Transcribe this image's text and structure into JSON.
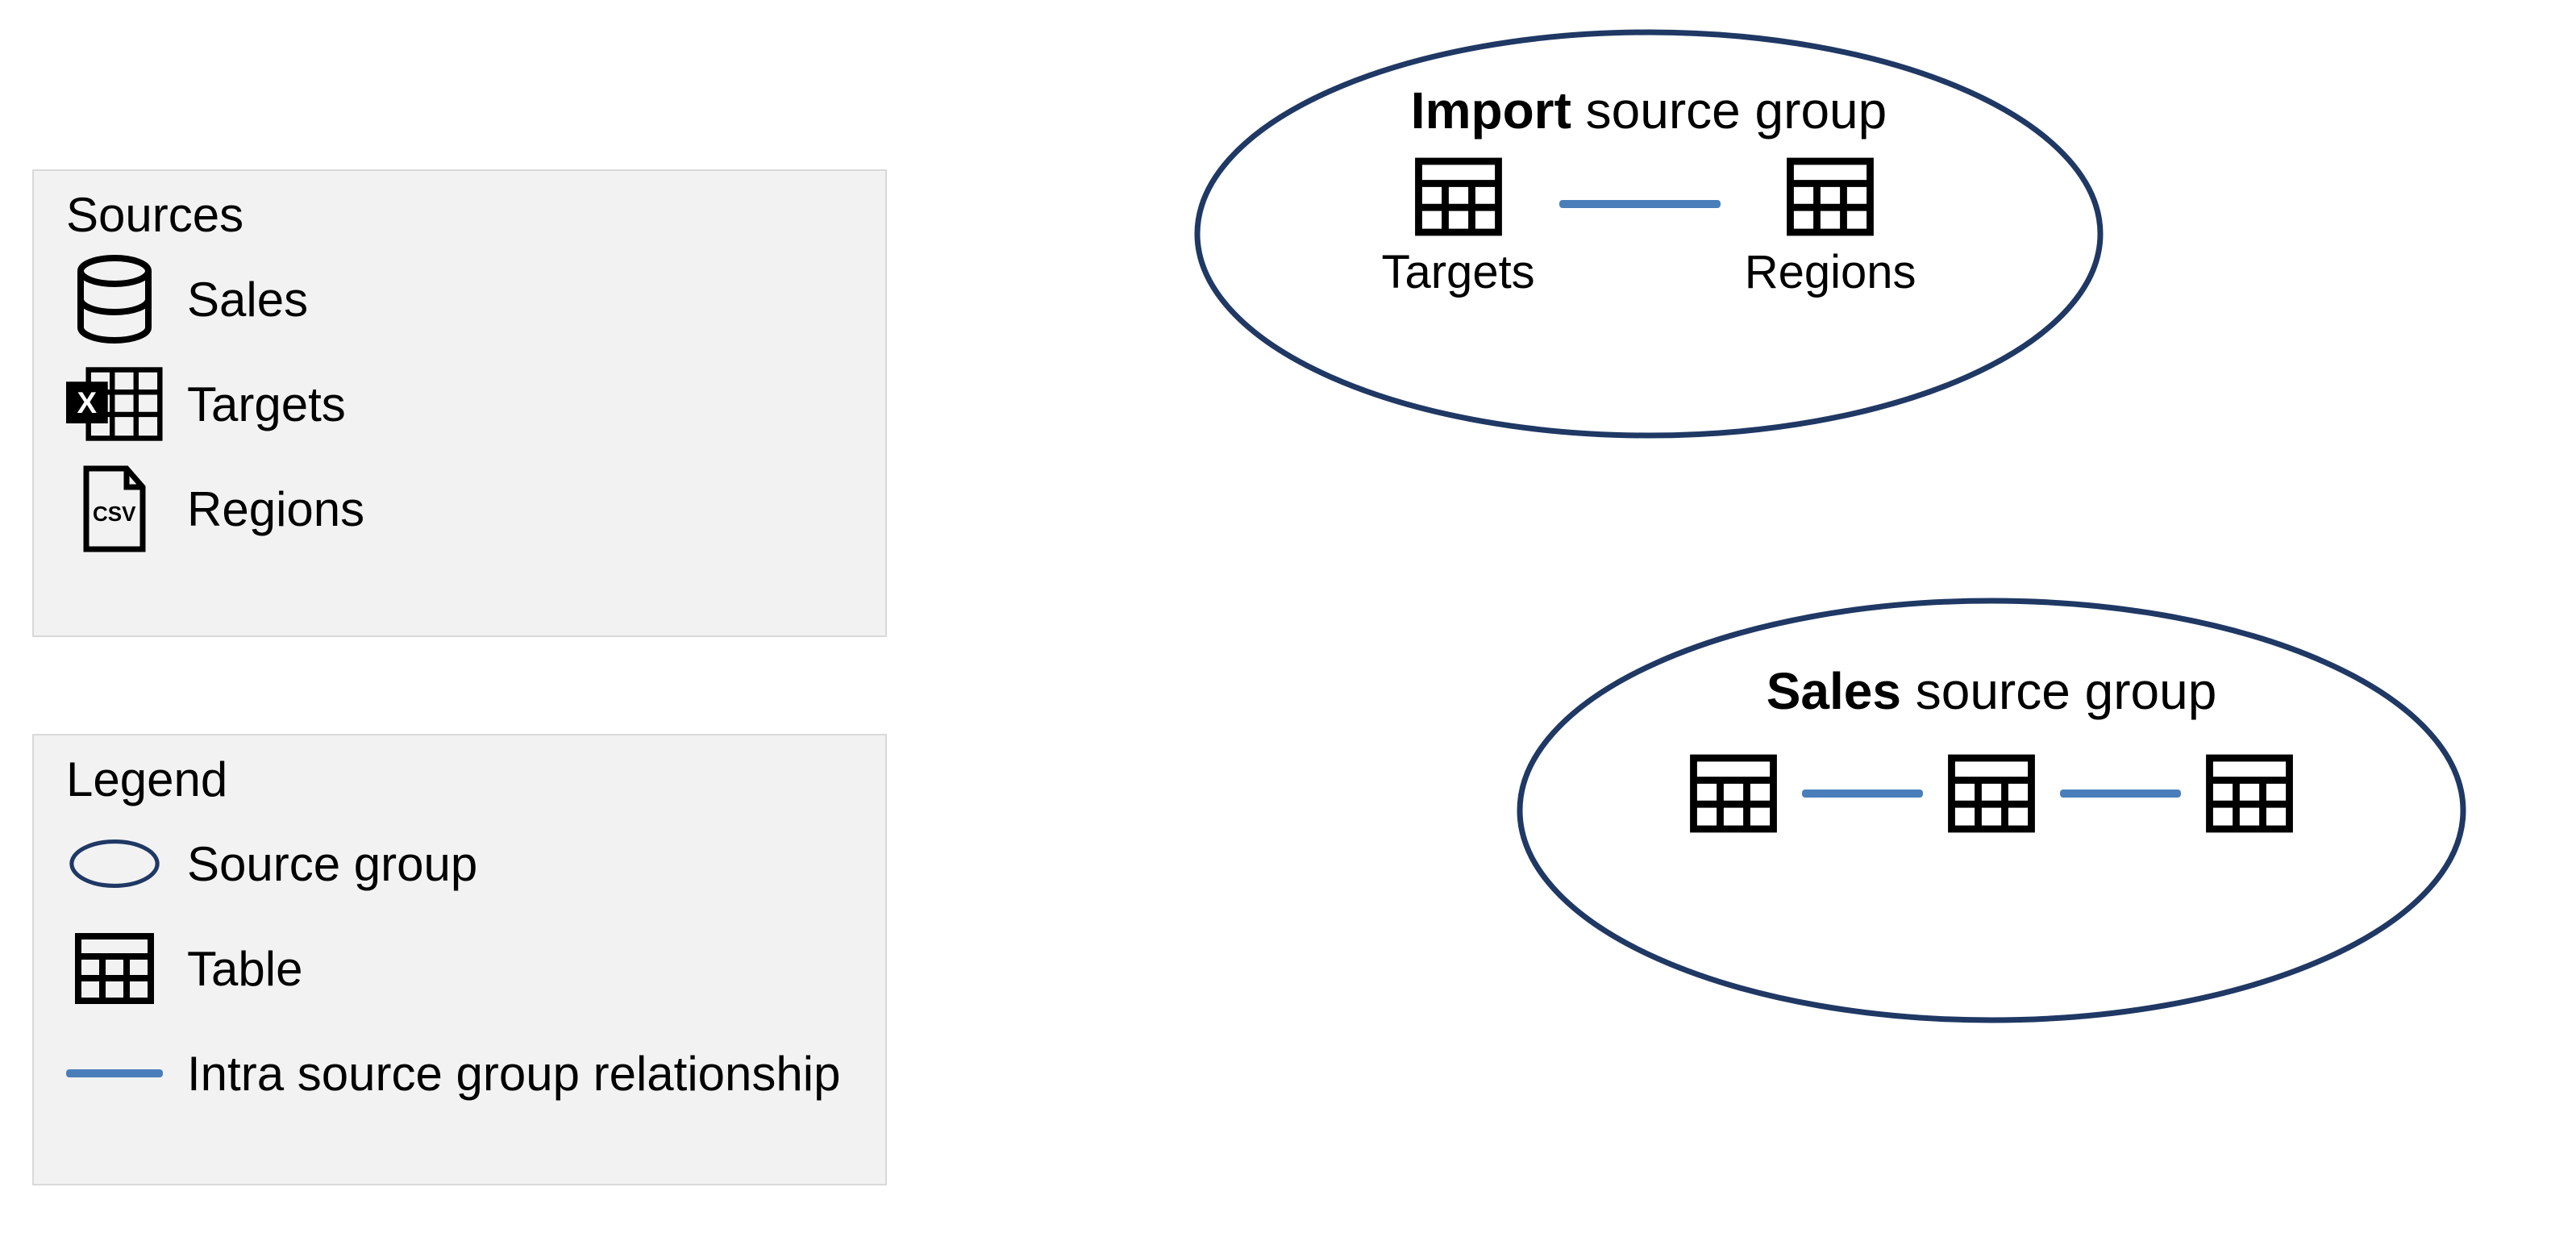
{
  "sources": {
    "title": "Sources",
    "items": [
      {
        "icon": "database",
        "label": "Sales"
      },
      {
        "icon": "excel",
        "label": "Targets"
      },
      {
        "icon": "csv",
        "label": "Regions"
      }
    ]
  },
  "legend": {
    "title": "Legend",
    "items": [
      {
        "icon": "ellipse",
        "label": "Source group"
      },
      {
        "icon": "table",
        "label": "Table"
      },
      {
        "icon": "line",
        "label": "Intra source group relationship"
      }
    ]
  },
  "groups": {
    "import": {
      "title_bold": "Import",
      "title_rest": " source group",
      "tables": [
        {
          "label": "Targets"
        },
        {
          "label": "Regions"
        }
      ]
    },
    "sales": {
      "title_bold": "Sales",
      "title_rest": " source group",
      "table_count": 3
    }
  },
  "colors": {
    "ellipse_stroke": "#1f3864",
    "connector": "#4a7ebb",
    "panel_bg": "#f2f2f2",
    "panel_border": "#d9d9d9"
  }
}
